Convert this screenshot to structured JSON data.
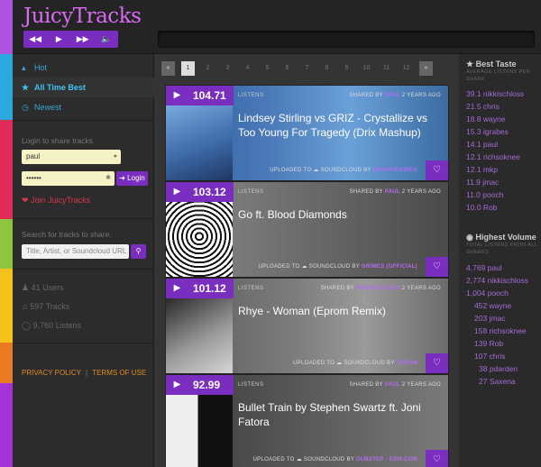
{
  "app": {
    "title": "JuicyTracks"
  },
  "player": {
    "controls": [
      "◀◀",
      "▶",
      "▶▶",
      "🔈"
    ]
  },
  "nav": {
    "hot": "Hot",
    "all_time_best": "All Time Best",
    "newest": "Newest"
  },
  "login": {
    "prompt": "Login to share tracks.",
    "username": "paul",
    "password": "••••••",
    "button": "Login",
    "join": "Join JuicyTracks"
  },
  "search": {
    "prompt": "Search for tracks to share.",
    "placeholder": "Title, Artist, or Soundcloud URL"
  },
  "stats": {
    "users": "41 Users",
    "tracks": "597 Tracks",
    "listens": "9,760 Listens"
  },
  "footer": {
    "privacy": "PRIVACY POLICY",
    "sep": "|",
    "terms": "TERMS OF USE"
  },
  "pager": {
    "prev": "«",
    "pages": [
      "1",
      "2",
      "3",
      "4",
      "5",
      "6",
      "7",
      "8",
      "9",
      "10",
      "11",
      "12"
    ],
    "next": "»"
  },
  "tracks": [
    {
      "score": "104.71",
      "listens_label": "LISTENS",
      "shared_prefix": "SHARED BY",
      "shared_user": "PAUL",
      "shared_time": "2 YEARS AGO",
      "title": "Lindsey Stirling vs GRIZ - Crystallize vs Too Young For Tragedy (Drix Mashup)",
      "uploaded_prefix": "UPLOADED TO",
      "uploaded_site": "SOUNDCLOUD",
      "by": "BY",
      "uploader": "BONAFIDEDRIX"
    },
    {
      "score": "103.12",
      "listens_label": "LISTENS",
      "shared_prefix": "SHARED BY",
      "shared_user": "PAUL",
      "shared_time": "2 YEARS AGO",
      "title": "Go ft. Blood Diamonds",
      "uploaded_prefix": "UPLOADED TO",
      "uploaded_site": "SOUNDCLOUD",
      "by": "BY",
      "uploader": "GRIMES (OFFICIAL)"
    },
    {
      "score": "101.12",
      "listens_label": "LISTENS",
      "shared_prefix": "SHARED BY",
      "shared_user": "NIKKISCHLOSS",
      "shared_time": "2 YEARS AGO",
      "title": "Rhye - Woman (Eprom Remix)",
      "uploaded_prefix": "UPLOADED TO",
      "uploaded_site": "SOUNDCLOUD",
      "by": "BY",
      "uploader": "EPROM"
    },
    {
      "score": "92.99",
      "listens_label": "LISTENS",
      "shared_prefix": "SHARED BY",
      "shared_user": "PAUL",
      "shared_time": "2 YEARS AGO",
      "title": "Bullet Train by Stephen Swartz ft. Joni Fatora",
      "uploaded_prefix": "UPLOADED TO",
      "uploaded_site": "SOUNDCLOUD",
      "by": "BY",
      "uploader": "DUBSTEP - EDM.COM"
    }
  ],
  "best_taste": {
    "title": "Best Taste",
    "subtitle": "AVERAGE LISTENS PER SHARE",
    "entries": [
      "39.1 nikkischloss",
      "21.5 chris",
      "18.8 wayne",
      "15.3 igrabes",
      "14.1 paul",
      "12.1 richsoknee",
      "12.1 mkp",
      "11.9 jmac",
      "11.0 pooch",
      "10.0 Rob"
    ]
  },
  "highest_volume": {
    "title": "Highest Volume",
    "subtitle": "TOTAL LISTENS FROM ALL SHARES",
    "entries": [
      "4,769 paul",
      "2,774 nikkischloss",
      "1,004 pooch",
      "452 wayne",
      "203 jmac",
      "158 richsoknee",
      "139 Rob",
      "107 chris",
      "38 pdarden",
      "27 Saxena"
    ]
  }
}
